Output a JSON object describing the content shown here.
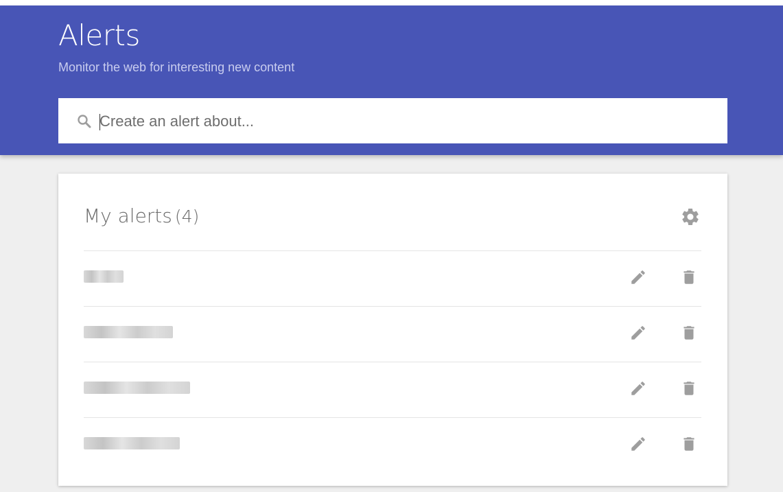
{
  "header": {
    "title": "Alerts",
    "subtitle": "Monitor the web for interesting new content",
    "background_color": "#4855b6"
  },
  "search": {
    "placeholder": "Create an alert about...",
    "value": "",
    "icon": "search-icon"
  },
  "alerts_card": {
    "title": "My alerts",
    "count": "(4)",
    "settings_icon": "gear-icon",
    "items": [
      {
        "label": "",
        "redacted": true,
        "edit_icon": "pencil-icon",
        "delete_icon": "trash-icon"
      },
      {
        "label": "",
        "redacted": true,
        "edit_icon": "pencil-icon",
        "delete_icon": "trash-icon"
      },
      {
        "label": "",
        "redacted": true,
        "edit_icon": "pencil-icon",
        "delete_icon": "trash-icon"
      },
      {
        "label": "",
        "redacted": true,
        "edit_icon": "pencil-icon",
        "delete_icon": "trash-icon"
      }
    ]
  },
  "colors": {
    "page_background": "#efefef",
    "icon_gray": "#9e9e9e",
    "divider": "#e4e4e4"
  }
}
